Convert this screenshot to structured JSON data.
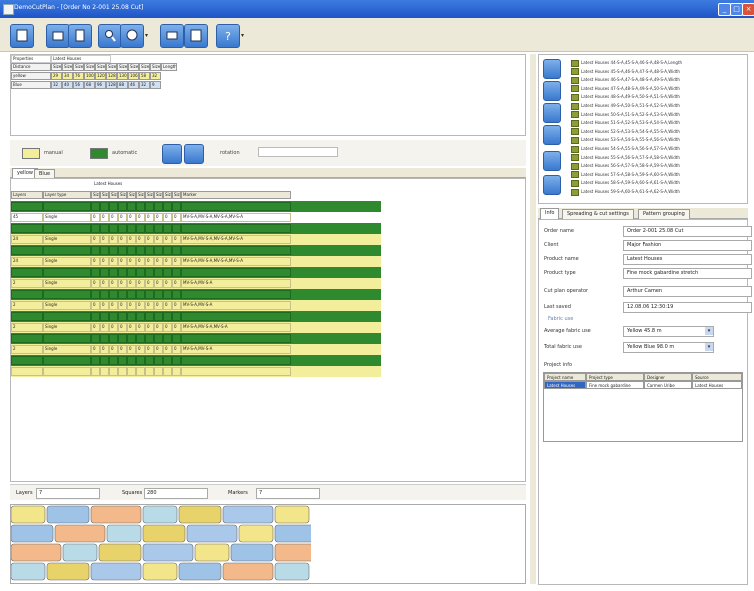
{
  "window": {
    "title": "DemoCutPlan - [Order No 2-001 25.08 Cut]"
  },
  "toolbar": {
    "buttons": [
      "new",
      "open",
      "save",
      "zoom",
      "tool",
      "print",
      "preview",
      "help"
    ]
  },
  "top_grid": {
    "header_row": [
      "Properties",
      "Latest Houses"
    ],
    "rows": [
      {
        "label": "Distance",
        "values": [
          "Size 1",
          "Size 2",
          "Size 3",
          "Size 4",
          "Size 5",
          "Size 6",
          "Size 7",
          "Size 8",
          "Size 9",
          "Size 10",
          "Length"
        ]
      },
      {
        "label": "yellow",
        "values": [
          "29",
          "34",
          "76",
          "100",
          "120",
          "128",
          "130",
          "106",
          "58",
          "32"
        ]
      },
      {
        "label": "Blue",
        "values": [
          "32",
          "40",
          "56",
          "68",
          "96",
          "128",
          "88",
          "46",
          "32",
          "9"
        ]
      }
    ]
  },
  "legend": {
    "manual": "manual",
    "automatic": "automatic",
    "rotation": "rotation",
    "manual_color": "#f3ee9b",
    "auto_color": "#2f8a2f"
  },
  "tabs": {
    "items": [
      "yellow",
      "Blue"
    ]
  },
  "main_grid": {
    "header_group": "Latest Houses",
    "headers": [
      "Layers",
      "Layer type",
      "Size 1",
      "Size 2",
      "Size 3",
      "Size 4",
      "Size 5",
      "Size 6",
      "Size 7",
      "Size 8",
      "Size 9",
      "Size 10",
      "Marker"
    ],
    "rows": [
      {
        "k": "g",
        "values": [
          "",
          "",
          "",
          "",
          "",
          "",
          "",
          "",
          "",
          "",
          "",
          "",
          ""
        ]
      },
      {
        "k": "w",
        "values": [
          "45",
          "Single",
          "0",
          "0",
          "0",
          "0",
          "0",
          "0",
          "0",
          "0",
          "0",
          "0",
          "MV-S-A,MV-S-A,MV-S-A,MV-S-A"
        ]
      },
      {
        "k": "g",
        "values": [
          "",
          "",
          "",
          "",
          "",
          "",
          "",
          "",
          "",
          "",
          "",
          "",
          ""
        ]
      },
      {
        "k": "y",
        "values": [
          "24",
          "Single",
          "0",
          "0",
          "0",
          "0",
          "0",
          "0",
          "0",
          "0",
          "0",
          "0",
          "MV-S-A,MV-S-A,MV-S-A,MV-S-A"
        ]
      },
      {
        "k": "g",
        "values": [
          "",
          "",
          "",
          "",
          "",
          "",
          "",
          "",
          "",
          "",
          "",
          "",
          ""
        ]
      },
      {
        "k": "y",
        "values": [
          "24",
          "Single",
          "0",
          "0",
          "0",
          "0",
          "0",
          "0",
          "0",
          "0",
          "0",
          "0",
          "MV-S-A,MV-S-A,MV-S-A,MV-S-A"
        ]
      },
      {
        "k": "g",
        "values": [
          "",
          "",
          "",
          "",
          "",
          "",
          "",
          "",
          "",
          "",
          "",
          "",
          ""
        ]
      },
      {
        "k": "y",
        "values": [
          "2",
          "Single",
          "0",
          "0",
          "0",
          "0",
          "0",
          "0",
          "0",
          "0",
          "0",
          "0",
          "MV-S-A,MV-S-A"
        ]
      },
      {
        "k": "g",
        "values": [
          "",
          "",
          "",
          "",
          "",
          "",
          "",
          "",
          "",
          "",
          "",
          "",
          ""
        ]
      },
      {
        "k": "y",
        "values": [
          "2",
          "Single",
          "0",
          "0",
          "0",
          "0",
          "0",
          "0",
          "0",
          "0",
          "0",
          "0",
          "MV-S-A,MV-S-A"
        ]
      },
      {
        "k": "g",
        "values": [
          "",
          "",
          "",
          "",
          "",
          "",
          "",
          "",
          "",
          "",
          "",
          "",
          ""
        ]
      },
      {
        "k": "y",
        "values": [
          "2",
          "Single",
          "0",
          "0",
          "0",
          "0",
          "0",
          "0",
          "0",
          "0",
          "0",
          "0",
          "MV-S-A,MV-S-A,MV-S-A"
        ]
      },
      {
        "k": "g",
        "values": [
          "",
          "",
          "",
          "",
          "",
          "",
          "",
          "",
          "",
          "",
          "",
          "",
          ""
        ]
      },
      {
        "k": "y",
        "values": [
          "2",
          "Single",
          "0",
          "0",
          "0",
          "0",
          "0",
          "0",
          "0",
          "0",
          "0",
          "0",
          "MV-S-A,MV-S-A"
        ]
      },
      {
        "k": "g",
        "values": [
          "",
          "",
          "",
          "",
          "",
          "",
          "",
          "",
          "",
          "",
          "",
          "",
          ""
        ]
      },
      {
        "k": "y",
        "values": [
          "",
          "",
          "",
          "",
          "",
          "",
          "",
          "",
          "",
          "",
          "",
          "",
          ""
        ]
      }
    ]
  },
  "status": {
    "layers_label": "Layers",
    "layers_value": "7",
    "squares_label": "Squares",
    "squares_value": "280",
    "markers_label": "Markers",
    "markers_value": "7"
  },
  "files": {
    "items": [
      "Latest Houses 44-S-A,45-S-A,46-S-A,48-S-A,Length",
      "Latest Houses 45-S-A,46-S-A,47-S-A,48-S-A,Width",
      "Latest Houses 46-S-A,47-S-A,48-S-A,49-S-A,Width",
      "Latest Houses 47-S-A,48-S-A,49-S-A,50-S-A,Width",
      "Latest Houses 48-S-A,49-S-A,50-S-A,51-S-A,Width",
      "Latest Houses 49-S-A,50-S-A,51-S-A,52-S-A,Width",
      "Latest Houses 50-S-A,51-S-A,52-S-A,53-S-A,Width",
      "Latest Houses 51-S-A,52-S-A,53-S-A,54-S-A,Width",
      "Latest Houses 52-S-A,53-S-A,54-S-A,55-S-A,Width",
      "Latest Houses 53-S-A,54-S-A,55-S-A,56-S-A,Width",
      "Latest Houses 54-S-A,55-S-A,56-S-A,57-S-A,Width",
      "Latest Houses 55-S-A,56-S-A,57-S-A,58-S-A,Width",
      "Latest Houses 56-S-A,57-S-A,58-S-A,59-S-A,Width",
      "Latest Houses 57-S-A,58-S-A,59-S-A,60-S-A,Width",
      "Latest Houses 58-S-A,59-S-A,60-S-A,61-S-A,Width",
      "Latest Houses 59-S-A,60-S-A,61-S-A,62-S-A,Width"
    ]
  },
  "info_tabs": {
    "items": [
      "Info",
      "Spreading & cut settings",
      "Pattern grouping"
    ]
  },
  "info": {
    "order_name_label": "Order name",
    "order_name": "Order 2-001 25.08 Cut",
    "client_label": "Client",
    "client": "Major Fashion",
    "product_name_label": "Product name",
    "product_name": "Latest Houses",
    "product_type_label": "Product type",
    "product_type": "Fine mock gabardine stretch",
    "cut_plan_operator_label": "Cut plan operator",
    "cut_plan_operator": "Arthur Camen",
    "last_saved_label": "Last saved",
    "last_saved": "12.08.06 12:30:19",
    "fabric_use_label": "Fabric use",
    "avg_fabric_use_label": "Average fabric use",
    "avg_fabric_use": "Yellow 45.8 m",
    "total_fabric_use_label": "Total fabric use",
    "total_fabric_use": "Yellow Blue 98.0 m",
    "project_info_label": "Project info",
    "project_headers": [
      "Project name",
      "Project type",
      "Designer",
      "Source"
    ],
    "project_values": [
      "Latest Houses",
      "Fine mock gabardine",
      "Carmen Uribe",
      "Latest Houses"
    ]
  }
}
